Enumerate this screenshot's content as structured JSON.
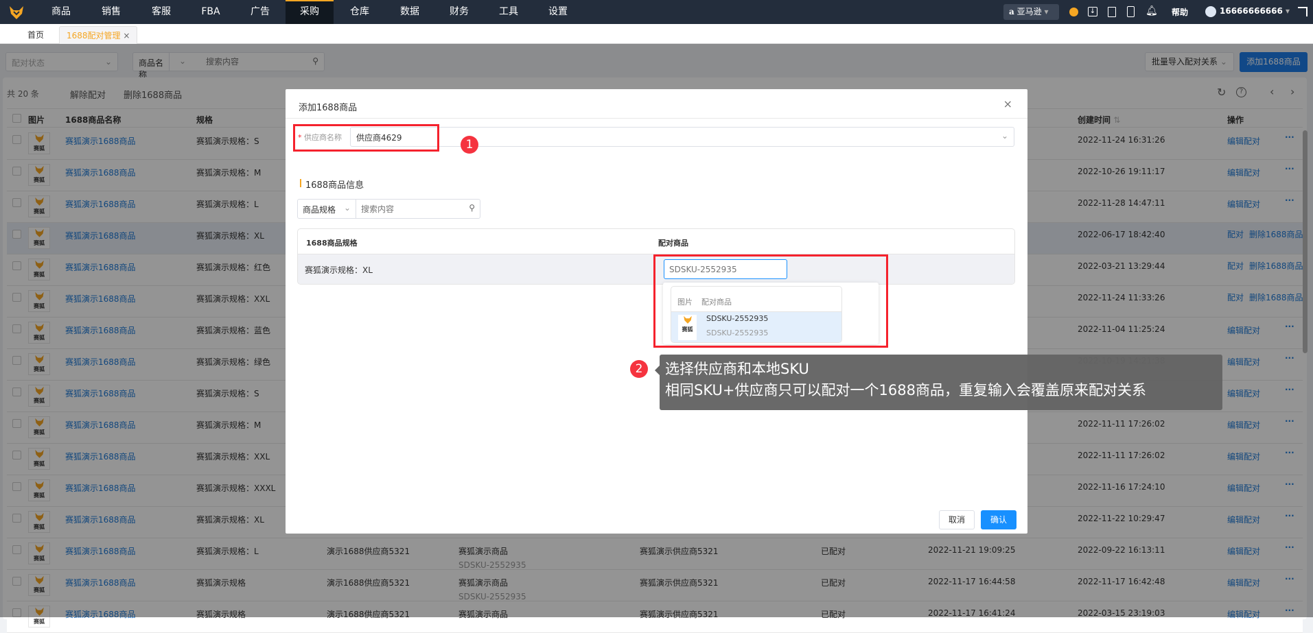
{
  "topnav": {
    "items": [
      "商品",
      "销售",
      "客服",
      "FBA",
      "广告",
      "采购",
      "仓库",
      "数据",
      "财务",
      "工具",
      "设置"
    ],
    "active": "采购",
    "platform": "亚马逊",
    "help": "帮助",
    "user": "16666666666"
  },
  "tabs": {
    "home": "首页",
    "current": "1688配对管理",
    "close": "×"
  },
  "filters": {
    "status_placeholder": "配对状态",
    "field_select": "商品名称",
    "search_placeholder": "搜索内容",
    "batch_import": "批量导入配对关系",
    "add_button": "添加1688商品"
  },
  "toolbar": {
    "total": "共 20 条",
    "unpair": "解除配对",
    "delete": "删除1688商品"
  },
  "table": {
    "headers": {
      "image": "图片",
      "name": "1688商品名称",
      "spec": "规格",
      "created": "创建时间",
      "ops": "操作"
    },
    "rows": [
      {
        "name": "赛狐演示1688商品",
        "spec": "赛狐演示规格：S",
        "created": "2022-11-24 16:31:26",
        "ops": [
          "编辑配对"
        ]
      },
      {
        "name": "赛狐演示1688商品",
        "spec": "赛狐演示规格：M",
        "created": "2022-10-26 19:11:17",
        "ops": [
          "编辑配对"
        ]
      },
      {
        "name": "赛狐演示1688商品",
        "spec": "赛狐演示规格：L",
        "created": "2022-11-28 14:47:11",
        "ops": [
          "编辑配对"
        ]
      },
      {
        "name": "赛狐演示1688商品",
        "spec": "赛狐演示规格：XL",
        "created": "2022-06-17 18:42:40",
        "ops": [
          "配对",
          "删除1688商品"
        ]
      },
      {
        "name": "赛狐演示1688商品",
        "spec": "赛狐演示规格：红色",
        "created": "2022-03-21 13:29:44",
        "ops": [
          "配对",
          "删除1688商品"
        ]
      },
      {
        "name": "赛狐演示1688商品",
        "spec": "赛狐演示规格：XXL",
        "created": "2022-11-24 11:33:26",
        "ops": [
          "配对",
          "删除1688商品"
        ]
      },
      {
        "name": "赛狐演示1688商品",
        "spec": "赛狐演示规格：蓝色",
        "created": "2022-11-04 11:25:24",
        "ops": [
          "编辑配对"
        ]
      },
      {
        "name": "赛狐演示1688商品",
        "spec": "赛狐演示规格：绿色",
        "created": "2022-10-19 14:21:38",
        "ops": [
          "编辑配对"
        ]
      },
      {
        "name": "赛狐演示1688商品",
        "spec": "赛狐演示规格：S",
        "ops": [
          "编辑配对"
        ]
      },
      {
        "name": "赛狐演示1688商品",
        "spec": "赛狐演示规格：M",
        "created": "2022-11-11 17:26:02",
        "ops": [
          "编辑配对"
        ]
      },
      {
        "name": "赛狐演示1688商品",
        "spec": "赛狐演示规格：XXL",
        "created": "2022-11-11 17:26:02",
        "ops": [
          "编辑配对"
        ]
      },
      {
        "name": "赛狐演示1688商品",
        "spec": "赛狐演示规格：XXXL",
        "created": "2022-11-16 17:24:10",
        "ops": [
          "编辑配对"
        ]
      },
      {
        "name": "赛狐演示1688商品",
        "spec": "赛狐演示规格：XL",
        "created": "2022-11-22 10:29:47",
        "ops": [
          "编辑配对"
        ]
      },
      {
        "name": "赛狐演示1688商品",
        "spec": "赛狐演示规格：L",
        "supplier1688": "演示1688供应商5321",
        "product": "赛狐演示商品",
        "sku": "SDSKU-2552935",
        "supplier": "赛狐演示供应商5321",
        "status": "已配对",
        "paired_time": "2022-11-21 19:09:25",
        "created": "2022-09-22 16:13:11",
        "ops": [
          "编辑配对"
        ]
      },
      {
        "name": "赛狐演示1688商品",
        "spec": "赛狐演示规格",
        "supplier1688": "演示1688供应商5321",
        "product": "赛狐演示商品",
        "sku": "SDSKU-2552935",
        "supplier": "赛狐演示供应商5321",
        "status": "已配对",
        "paired_time": "2022-11-17 16:44:58",
        "created": "2022-11-17 16:42:48",
        "ops": [
          "编辑配对"
        ]
      },
      {
        "name": "赛狐演示1688商品",
        "spec": "赛狐演示规格",
        "supplier1688": "演示1688供应商5321",
        "product": "赛狐演示商品",
        "supplier": "赛狐演示供应商5321",
        "status": "已配对",
        "paired_time": "2022-11-17 16:41:24",
        "created": "2022-03-15 23:19:03",
        "ops": [
          "编辑配对"
        ]
      }
    ],
    "thumb_text": "赛狐",
    "more": "···"
  },
  "modal": {
    "title": "添加1688商品",
    "supplier_label": "供应商名称",
    "required": "*",
    "supplier_value": "供应商4629",
    "section_title": "1688商品信息",
    "search_field": "商品规格",
    "search_placeholder": "搜索内容",
    "col_spec": "1688商品规格",
    "col_pair": "配对商品",
    "row_spec": "赛狐演示规格：XL",
    "sku_placeholder": "SDSKU-2552935",
    "dropdown": {
      "col_image": "图片",
      "col_product": "配对商品",
      "item_title": "SDSKU-2552935",
      "item_sub": "SDSKU-2552935",
      "thumb_text": "赛狐"
    },
    "cancel": "取消",
    "confirm": "确认"
  },
  "annotations": {
    "badge1": "1",
    "badge2": "2",
    "tip_line1": "选择供应商和本地SKU",
    "tip_line2": "相同SKU+供应商只可以配对一个1688商品，重复输入会覆盖原来配对关系"
  },
  "colors": {
    "accent": "#f5a623",
    "primary": "#1890ff",
    "link": "#1f7ad8",
    "nav": "#232d3c",
    "annotation": "#f5222d"
  }
}
